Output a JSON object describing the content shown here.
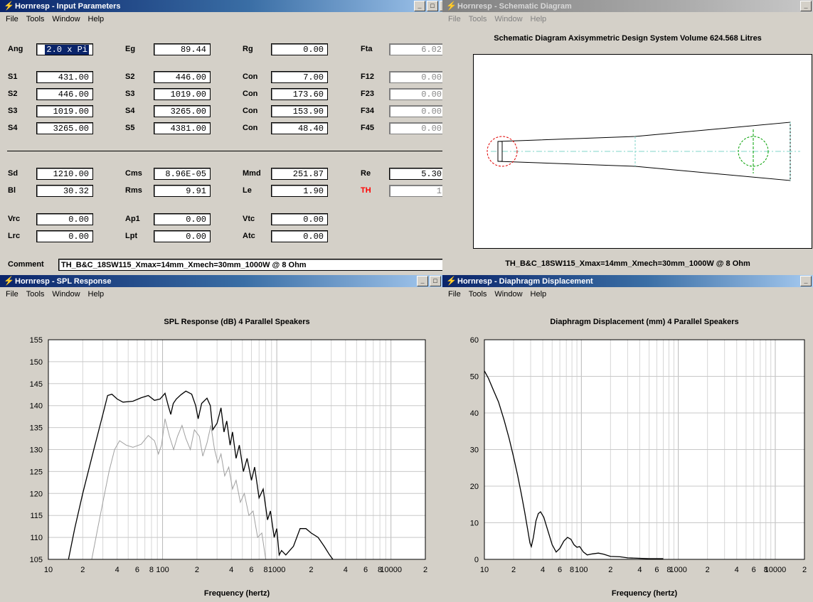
{
  "windows": {
    "input": {
      "title": "Hornresp - Input Parameters",
      "menu": [
        "File",
        "Tools",
        "Window",
        "Help"
      ]
    },
    "schematic": {
      "title": "Hornresp - Schematic Diagram",
      "menu": [
        "File",
        "Tools",
        "Window",
        "Help"
      ]
    },
    "spl": {
      "title": "Hornresp - SPL Response",
      "menu": [
        "File",
        "Tools",
        "Window",
        "Help"
      ]
    },
    "disp": {
      "title": "Hornresp - Diaphragm Displacement",
      "menu": [
        "File",
        "Tools",
        "Window",
        "Help"
      ]
    }
  },
  "controls": {
    "minimize": "_",
    "maximize": "□",
    "close": "✕"
  },
  "params": {
    "ang": {
      "label": "Ang",
      "value": "2.0 x Pi"
    },
    "eg": {
      "label": "Eg",
      "value": "89.44"
    },
    "rg": {
      "label": "Rg",
      "value": "0.00"
    },
    "fta": {
      "label": "Fta",
      "value": "6.02"
    },
    "s1a": {
      "label": "S1",
      "value": "431.00"
    },
    "s2b": {
      "label": "S2",
      "value": "446.00"
    },
    "con1": {
      "label": "Con",
      "value": "7.00"
    },
    "f12": {
      "label": "F12",
      "value": "0.00"
    },
    "s2a": {
      "label": "S2",
      "value": "446.00"
    },
    "s3b": {
      "label": "S3",
      "value": "1019.00"
    },
    "con2": {
      "label": "Con",
      "value": "173.60"
    },
    "f23": {
      "label": "F23",
      "value": "0.00"
    },
    "s3a": {
      "label": "S3",
      "value": "1019.00"
    },
    "s4b": {
      "label": "S4",
      "value": "3265.00"
    },
    "con3": {
      "label": "Con",
      "value": "153.90"
    },
    "f34": {
      "label": "F34",
      "value": "0.00"
    },
    "s4a": {
      "label": "S4",
      "value": "3265.00"
    },
    "s5b": {
      "label": "S5",
      "value": "4381.00"
    },
    "con4": {
      "label": "Con",
      "value": "48.40"
    },
    "f45": {
      "label": "F45",
      "value": "0.00"
    },
    "sd": {
      "label": "Sd",
      "value": "1210.00"
    },
    "cms": {
      "label": "Cms",
      "value": "8.96E-05"
    },
    "mmd": {
      "label": "Mmd",
      "value": "251.87"
    },
    "re": {
      "label": "Re",
      "value": "5.30"
    },
    "bl": {
      "label": "Bl",
      "value": "30.32"
    },
    "rms": {
      "label": "Rms",
      "value": "9.91"
    },
    "le": {
      "label": "Le",
      "value": "1.90"
    },
    "th": {
      "label": "TH",
      "value": "1"
    },
    "vrc": {
      "label": "Vrc",
      "value": "0.00"
    },
    "ap1": {
      "label": "Ap1",
      "value": "0.00"
    },
    "vtc": {
      "label": "Vtc",
      "value": "0.00"
    },
    "lrc": {
      "label": "Lrc",
      "value": "0.00"
    },
    "lpt": {
      "label": "Lpt",
      "value": "0.00"
    },
    "atc": {
      "label": "Atc",
      "value": "0.00"
    },
    "comment": {
      "label": "Comment",
      "value": "TH_B&C_18SW115_Xmax=14mm_Xmech=30mm_1000W @ 8 Ohm"
    }
  },
  "colors": {
    "th_label": "#ff0000",
    "circle_red": "#e00000",
    "circle_green": "#00a000",
    "axis_line": "#7fd6c8"
  },
  "schematic": {
    "heading": "Schematic Diagram   Axisymmetric Design   System Volume 624.568 Litres",
    "caption": "TH_B&C_18SW115_Xmax=14mm_Xmech=30mm_1000W @ 8 Ohm"
  },
  "chart_data": [
    {
      "type": "line",
      "title": "SPL Response (dB)   4 Parallel Speakers",
      "xlabel": "Frequency (hertz)",
      "ylabel": "",
      "xscale": "log",
      "xlim": [
        10,
        20000
      ],
      "ylim": [
        105,
        155
      ],
      "yticks": [
        105,
        110,
        115,
        120,
        125,
        130,
        135,
        140,
        145,
        150,
        155
      ],
      "xtick_labels": [
        {
          "f": 10,
          "t": "10"
        },
        {
          "f": 20,
          "t": "2"
        },
        {
          "f": 40,
          "t": "4"
        },
        {
          "f": 60,
          "t": "6"
        },
        {
          "f": 80,
          "t": "8"
        },
        {
          "f": 100,
          "t": "100"
        },
        {
          "f": 200,
          "t": "2"
        },
        {
          "f": 400,
          "t": "4"
        },
        {
          "f": 600,
          "t": "6"
        },
        {
          "f": 800,
          "t": "8"
        },
        {
          "f": 1000,
          "t": "1000"
        },
        {
          "f": 2000,
          "t": "2"
        },
        {
          "f": 4000,
          "t": "4"
        },
        {
          "f": 6000,
          "t": "6"
        },
        {
          "f": 8000,
          "t": "8"
        },
        {
          "f": 10000,
          "t": "10000"
        },
        {
          "f": 20000,
          "t": "2"
        }
      ],
      "series": [
        {
          "color": "#000000",
          "points": [
            [
              15,
              105
            ],
            [
              17,
              112
            ],
            [
              20,
              120
            ],
            [
              25,
              130
            ],
            [
              30,
              138
            ],
            [
              33,
              142.3
            ],
            [
              36,
              142.6
            ],
            [
              40,
              141.5
            ],
            [
              45,
              140.8
            ],
            [
              55,
              141
            ],
            [
              65,
              141.8
            ],
            [
              75,
              142.3
            ],
            [
              85,
              141.2
            ],
            [
              95,
              141.5
            ],
            [
              105,
              142.8
            ],
            [
              112,
              140
            ],
            [
              118,
              138
            ],
            [
              124,
              140.5
            ],
            [
              132,
              141.5
            ],
            [
              145,
              142.5
            ],
            [
              160,
              143.3
            ],
            [
              180,
              142.6
            ],
            [
              195,
              140
            ],
            [
              205,
              137
            ],
            [
              220,
              140.5
            ],
            [
              245,
              141.7
            ],
            [
              262,
              140
            ],
            [
              275,
              134.5
            ],
            [
              300,
              136
            ],
            [
              325,
              139.5
            ],
            [
              345,
              134
            ],
            [
              365,
              136.5
            ],
            [
              390,
              131
            ],
            [
              410,
              134
            ],
            [
              440,
              128
            ],
            [
              470,
              131
            ],
            [
              510,
              125
            ],
            [
              550,
              128
            ],
            [
              600,
              123
            ],
            [
              640,
              126
            ],
            [
              700,
              119
            ],
            [
              760,
              121
            ],
            [
              830,
              114
            ],
            [
              880,
              116
            ],
            [
              950,
              110
            ],
            [
              1000,
              112
            ],
            [
              1050,
              106
            ],
            [
              1100,
              107
            ],
            [
              1200,
              106
            ],
            [
              1400,
              108
            ],
            [
              1600,
              112
            ],
            [
              1800,
              112
            ],
            [
              2000,
              111
            ],
            [
              2300,
              110
            ],
            [
              2600,
              108
            ],
            [
              2900,
              106
            ],
            [
              3100,
              105
            ]
          ]
        },
        {
          "color": "#a0a0a0",
          "points": [
            [
              24,
              105
            ],
            [
              27,
              112
            ],
            [
              30,
              118
            ],
            [
              34,
              125
            ],
            [
              38,
              130
            ],
            [
              42,
              132
            ],
            [
              48,
              131
            ],
            [
              55,
              130.5
            ],
            [
              65,
              131.2
            ],
            [
              75,
              133.2
            ],
            [
              85,
              132
            ],
            [
              92,
              129
            ],
            [
              98,
              131
            ],
            [
              105,
              137
            ],
            [
              115,
              133
            ],
            [
              125,
              130
            ],
            [
              135,
              133
            ],
            [
              148,
              135.5
            ],
            [
              160,
              132.5
            ],
            [
              175,
              130
            ],
            [
              190,
              134.5
            ],
            [
              210,
              133
            ],
            [
              225,
              128.5
            ],
            [
              245,
              131.5
            ],
            [
              265,
              135.5
            ],
            [
              285,
              130
            ],
            [
              305,
              127
            ],
            [
              325,
              129
            ],
            [
              350,
              124
            ],
            [
              380,
              126
            ],
            [
              410,
              121
            ],
            [
              440,
              123
            ],
            [
              480,
              118
            ],
            [
              520,
              120
            ],
            [
              570,
              115
            ],
            [
              620,
              116
            ],
            [
              680,
              110
            ],
            [
              740,
              111
            ],
            [
              800,
              105
            ]
          ]
        }
      ]
    },
    {
      "type": "line",
      "title": "Diaphragm Displacement (mm)   4 Parallel Speakers",
      "xlabel": "Frequency (hertz)",
      "ylabel": "",
      "xscale": "log",
      "xlim": [
        10,
        20000
      ],
      "ylim": [
        0,
        60
      ],
      "yticks": [
        0,
        10,
        20,
        30,
        40,
        50,
        60
      ],
      "xtick_labels": [
        {
          "f": 10,
          "t": "10"
        },
        {
          "f": 20,
          "t": "2"
        },
        {
          "f": 40,
          "t": "4"
        },
        {
          "f": 60,
          "t": "6"
        },
        {
          "f": 80,
          "t": "8"
        },
        {
          "f": 100,
          "t": "100"
        },
        {
          "f": 200,
          "t": "2"
        },
        {
          "f": 400,
          "t": "4"
        },
        {
          "f": 600,
          "t": "6"
        },
        {
          "f": 800,
          "t": "8"
        },
        {
          "f": 1000,
          "t": "1000"
        },
        {
          "f": 2000,
          "t": "2"
        },
        {
          "f": 4000,
          "t": "4"
        },
        {
          "f": 6000,
          "t": "6"
        },
        {
          "f": 8000,
          "t": "8"
        },
        {
          "f": 10000,
          "t": "10000"
        },
        {
          "f": 20000,
          "t": "2"
        }
      ],
      "series": [
        {
          "color": "#000000",
          "points": [
            [
              10,
              51.5
            ],
            [
              11,
              49.5
            ],
            [
              12.5,
              46
            ],
            [
              14,
              43
            ],
            [
              16,
              38
            ],
            [
              18,
              33
            ],
            [
              20,
              28
            ],
            [
              22,
              23
            ],
            [
              24,
              18
            ],
            [
              26,
              13
            ],
            [
              28,
              8
            ],
            [
              29.5,
              4.5
            ],
            [
              30.5,
              3.5
            ],
            [
              32,
              6
            ],
            [
              34,
              10.5
            ],
            [
              36,
              12.5
            ],
            [
              38,
              13
            ],
            [
              41,
              11.5
            ],
            [
              45,
              8
            ],
            [
              50,
              4
            ],
            [
              55,
              2
            ],
            [
              60,
              3
            ],
            [
              66,
              5
            ],
            [
              72,
              6
            ],
            [
              78,
              5.5
            ],
            [
              84,
              4
            ],
            [
              90,
              3.3
            ],
            [
              96,
              3.5
            ],
            [
              105,
              2
            ],
            [
              115,
              1.2
            ],
            [
              130,
              1.5
            ],
            [
              150,
              1.7
            ],
            [
              170,
              1.4
            ],
            [
              200,
              0.8
            ],
            [
              250,
              0.7
            ],
            [
              300,
              0.4
            ],
            [
              400,
              0.3
            ],
            [
              500,
              0.2
            ],
            [
              700,
              0.2
            ]
          ]
        }
      ]
    }
  ]
}
